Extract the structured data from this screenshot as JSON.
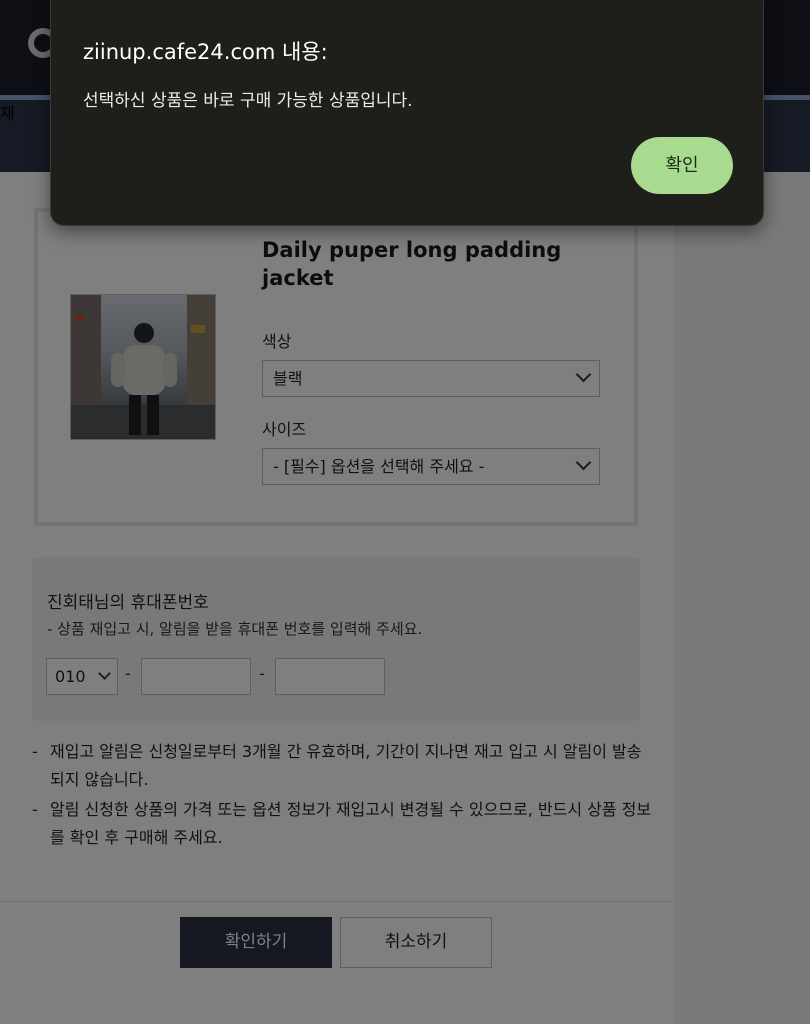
{
  "background": {
    "nav_label": "재",
    "product": {
      "title": "Daily puper long padding jacket",
      "color_label": "색상",
      "color_value": "블랙",
      "size_label": "사이즈",
      "size_value": "- [필수] 옵션을 선택해 주세요 -"
    },
    "phone": {
      "title": "진회태님의 휴대폰번호",
      "description": "- 상품 재입고 시, 알림을 받을 휴대폰 번호를 입력해 주세요.",
      "prefix": "010",
      "separator": "-"
    },
    "notices": [
      {
        "bullet": "-",
        "text": "재입고 알림은 신청일로부터 3개월 간 유효하며, 기간이 지나면 재고 입고 시 알림이 발송되지 않습니다."
      },
      {
        "bullet": "-",
        "text": "알림 신청한 상품의 가격 또는 옵션 정보가 재입고시 변경될 수 있으므로, 반드시 상품 정보를 확인 후 구매해 주세요."
      }
    ],
    "buttons": {
      "confirm": "확인하기",
      "cancel": "취소하기"
    }
  },
  "alert": {
    "title": "ziinup.cafe24.com 내용:",
    "message": "선택하신 상품은 바로 구매 가능한 상품입니다.",
    "ok_label": "확인",
    "accent_color": "#a8db8f"
  }
}
